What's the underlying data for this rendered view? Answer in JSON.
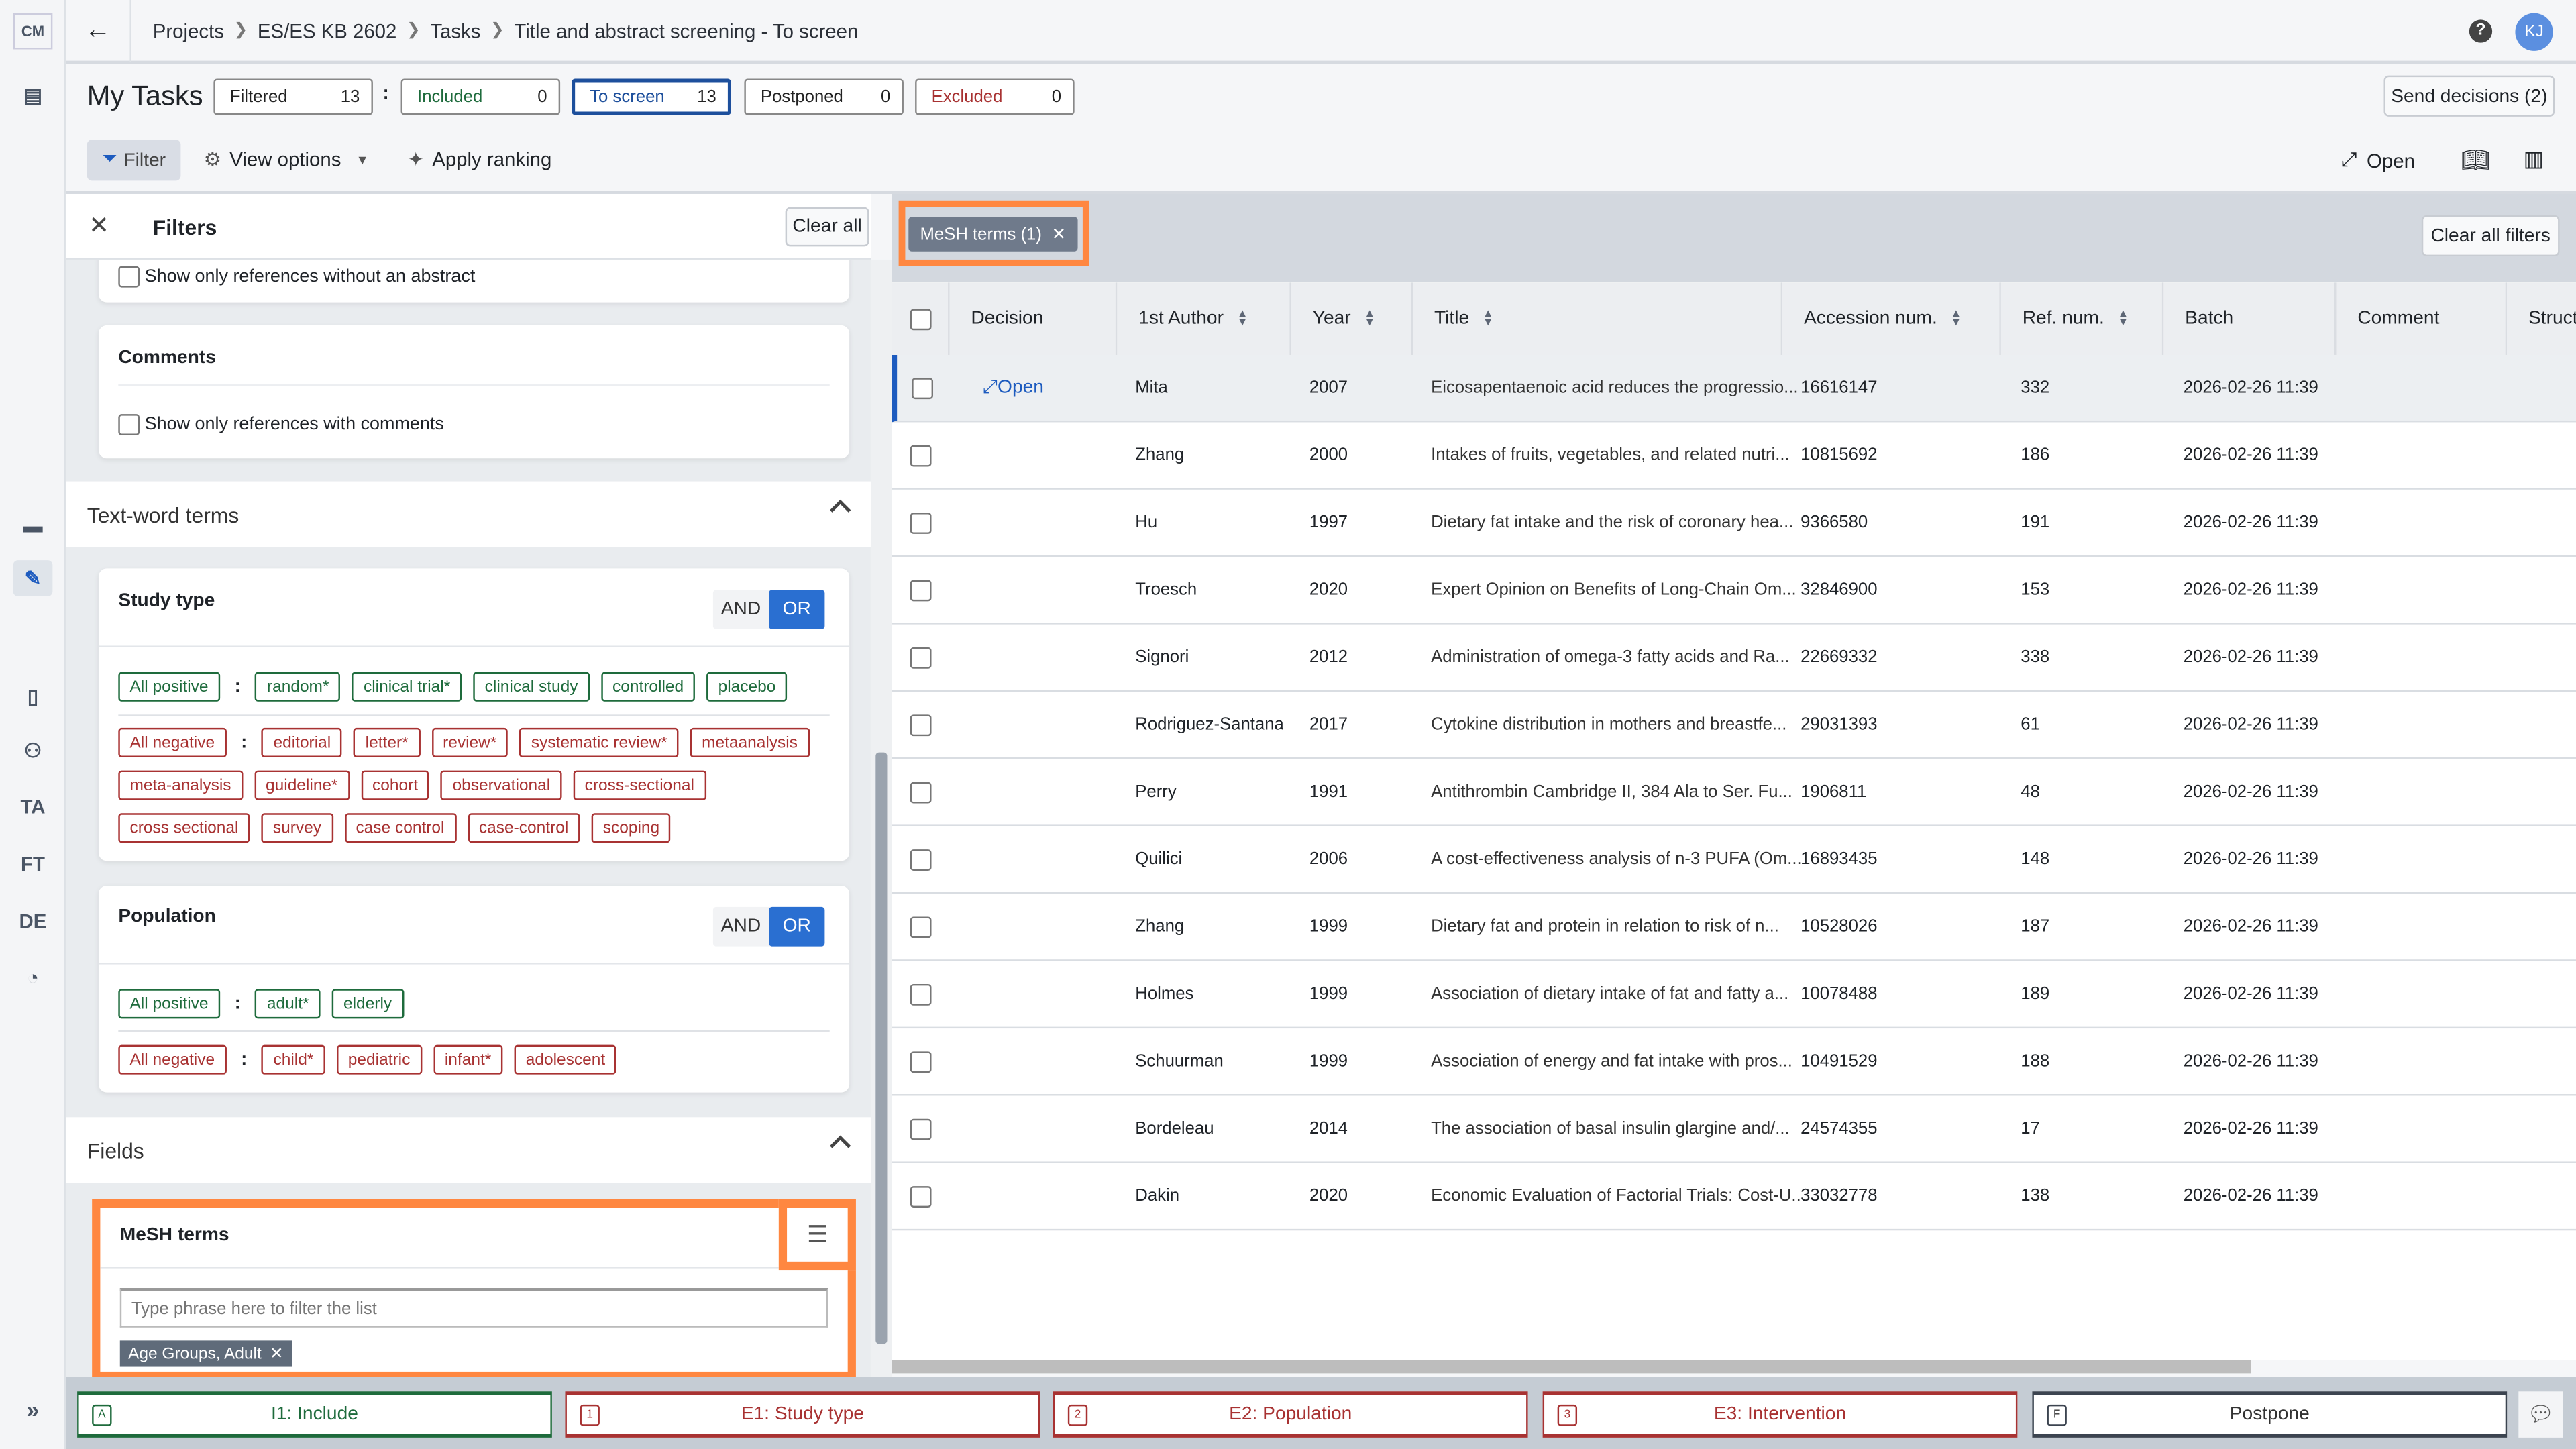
{
  "rail": {
    "logo": "CM",
    "ta": "TA",
    "ft": "FT",
    "de": "DE"
  },
  "breadcrumb": [
    "Projects",
    "ES/ES KB 2602",
    "Tasks",
    "Title and abstract screening - To screen"
  ],
  "user_initials": "KJ",
  "page_title": "My Tasks",
  "counters": [
    {
      "label": "Filtered",
      "value": "13",
      "color": "#222222"
    },
    {
      "label": "Included",
      "value": "0",
      "color": "#1e6b3c"
    },
    {
      "label": "To screen",
      "value": "13",
      "color": "#1d4f9c"
    },
    {
      "label": "Postponed",
      "value": "0",
      "color": "#222222"
    },
    {
      "label": "Excluded",
      "value": "0",
      "color": "#a83232"
    }
  ],
  "counter_sep": ":",
  "send_decisions": "Send decisions (2)",
  "toolbar": {
    "filter": "Filter",
    "view_options": "View options",
    "apply_ranking": "Apply ranking",
    "open": "Open"
  },
  "filters": {
    "title": "Filters",
    "clear_all": "Clear all",
    "no_abstract": "Show only references without an abstract",
    "comments_title": "Comments",
    "with_comments": "Show only references with comments",
    "textword_title": "Text-word terms",
    "study_type": {
      "title": "Study type",
      "and": "AND",
      "or": "OR",
      "pos_label": "All positive",
      "neg_label": "All negative",
      "positive": [
        "random*",
        "clinical trial*",
        "clinical study",
        "controlled",
        "placebo"
      ],
      "negative": [
        "editorial",
        "letter*",
        "review*",
        "systematic review*",
        "metaanalysis",
        "meta-analysis",
        "guideline*",
        "cohort",
        "observational",
        "cross-sectional",
        "cross sectional",
        "survey",
        "case control",
        "case-control",
        "scoping"
      ]
    },
    "population": {
      "title": "Population",
      "and": "AND",
      "or": "OR",
      "pos_label": "All positive",
      "neg_label": "All negative",
      "positive": [
        "adult*",
        "elderly"
      ],
      "negative": [
        "child*",
        "pediatric",
        "infant*",
        "adolescent"
      ]
    },
    "fields_title": "Fields",
    "mesh": {
      "title": "MeSH terms",
      "placeholder": "Type phrase here to filter the list",
      "selected": "Age Groups, Adult"
    }
  },
  "active_filter_chip": "MeSH terms (1)",
  "clear_all_filters": "Clear all filters",
  "table": {
    "columns": [
      "Decision",
      "1st Author",
      "Year",
      "Title",
      "Accession num.",
      "Ref. num.",
      "Batch",
      "Comment",
      "Struct"
    ],
    "open_label": "Open",
    "rows": [
      [
        "Mita",
        "2007",
        "Eicosapentaenoic acid reduces the progressio...",
        "16616147",
        "332",
        "2026-02-26 11:39"
      ],
      [
        "Zhang",
        "2000",
        "Intakes of fruits, vegetables, and related nutri...",
        "10815692",
        "186",
        "2026-02-26 11:39"
      ],
      [
        "Hu",
        "1997",
        "Dietary fat intake and the risk of coronary hea...",
        "9366580",
        "191",
        "2026-02-26 11:39"
      ],
      [
        "Troesch",
        "2020",
        "Expert Opinion on Benefits of Long-Chain Om...",
        "32846900",
        "153",
        "2026-02-26 11:39"
      ],
      [
        "Signori",
        "2012",
        "Administration of omega-3 fatty acids and Ra...",
        "22669332",
        "338",
        "2026-02-26 11:39"
      ],
      [
        "Rodriguez-Santana",
        "2017",
        "Cytokine distribution in mothers and breastfe...",
        "29031393",
        "61",
        "2026-02-26 11:39"
      ],
      [
        "Perry",
        "1991",
        "Antithrombin Cambridge II, 384 Ala to Ser. Fu...",
        "1906811",
        "48",
        "2026-02-26 11:39"
      ],
      [
        "Quilici",
        "2006",
        "A cost-effectiveness analysis of n-3 PUFA (Om...",
        "16893435",
        "148",
        "2026-02-26 11:39"
      ],
      [
        "Zhang",
        "1999",
        "Dietary fat and protein in relation to risk of n...",
        "10528026",
        "187",
        "2026-02-26 11:39"
      ],
      [
        "Holmes",
        "1999",
        "Association of dietary intake of fat and fatty a...",
        "10078488",
        "189",
        "2026-02-26 11:39"
      ],
      [
        "Schuurman",
        "1999",
        "Association of energy and fat intake with pros...",
        "10491529",
        "188",
        "2026-02-26 11:39"
      ],
      [
        "Bordeleau",
        "2014",
        "The association of basal insulin glargine and/...",
        "24574355",
        "17",
        "2026-02-26 11:39"
      ],
      [
        "Dakin",
        "2020",
        "Economic Evaluation of Factorial Trials: Cost-U...",
        "33032778",
        "138",
        "2026-02-26 11:39"
      ]
    ]
  },
  "decisions": [
    {
      "key": "A",
      "label": "I1: Include",
      "color": "#1e6b3c"
    },
    {
      "key": "1",
      "label": "E1: Study type",
      "color": "#a83232"
    },
    {
      "key": "2",
      "label": "E2: Population",
      "color": "#a83232"
    },
    {
      "key": "3",
      "label": "E3: Intervention",
      "color": "#a83232"
    },
    {
      "key": "F",
      "label": "Postpone",
      "color": "#3c4450"
    }
  ],
  "colors": {
    "accent": "#2a6fd1",
    "highlight": "#ff8740"
  }
}
